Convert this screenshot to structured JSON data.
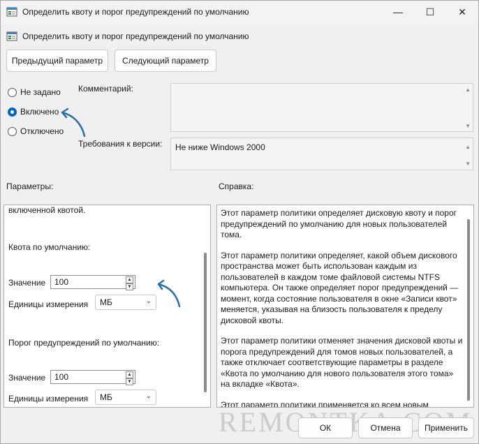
{
  "window": {
    "title": "Определить квоту и порог предупреждений по умолчанию",
    "minimize": "—",
    "maximize": "☐",
    "close": "✕"
  },
  "header": {
    "policy_title": "Определить квоту и порог предупреждений по умолчанию"
  },
  "nav": {
    "prev_label": "Предыдущий параметр",
    "next_label": "Следующий параметр"
  },
  "state": {
    "options": [
      {
        "label": "Не задано",
        "checked": false
      },
      {
        "label": "Включено",
        "checked": true
      },
      {
        "label": "Отключено",
        "checked": false
      }
    ]
  },
  "comment": {
    "label": "Комментарий:",
    "value": ""
  },
  "requirements": {
    "label": "Требования к версии:",
    "value": "Не ниже Windows 2000"
  },
  "params": {
    "header": "Параметры:",
    "intro_text": "включенной квотой.",
    "default_quota_label": "Квота по умолчанию:",
    "value1_label": "Значение",
    "value1": "100",
    "units1_label": "Единицы измерения",
    "units1": "МБ",
    "warning_label": "Порог предупреждений по умолчанию:",
    "value2_label": "Значение",
    "value2": "100",
    "units2_label": "Единицы измерения",
    "units2": "МБ"
  },
  "help": {
    "header": "Справка:",
    "p1": "Этот параметр политики определяет дисковую квоту и порог предупреждений по умолчанию для новых пользователей тома.",
    "p2": "Этот параметр политики определяет, какой объем дискового пространства может быть использован каждым из пользователей в каждом томе файловой системы NTFS компьютера. Он также определяет порог предупреждений — момент, когда состояние пользователя в окне «Записи квот» меняется, указывая на близость пользователя к пределу дисковой квоты.",
    "p3": "Этот параметр политики отменяет значения дисковой квоты и порога предупреждений для томов новых пользователей, а также отключает соответствующие параметры в разделе «Квота по умолчанию для нового пользователя этого тома» на вкладке «Квота».",
    "p4": "Этот параметр политики применяется ко всем новым"
  },
  "footer": {
    "ok_label": "ОК",
    "cancel_label": "Отмена",
    "apply_label": "Применить"
  },
  "watermark": "REMONTKA.COM",
  "colors": {
    "accent": "#0067c0",
    "arrow": "#2c6fae"
  }
}
